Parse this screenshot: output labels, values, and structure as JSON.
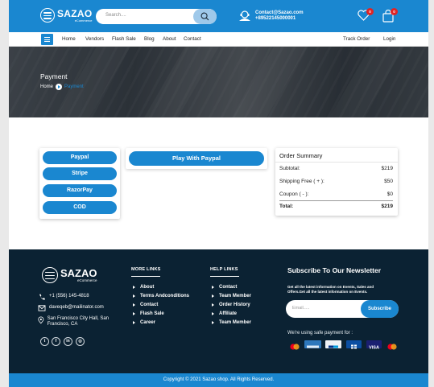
{
  "brand": {
    "name": "SAZAO",
    "tagline": "eCommerce"
  },
  "search": {
    "placeholder": "Search....",
    "icon": "search-icon"
  },
  "header_contact": {
    "email": "Contact@Sazao.com",
    "phone": "+89522145000001"
  },
  "wishlist": {
    "count": "0",
    "icon": "heart-icon"
  },
  "cart": {
    "count": "0",
    "icon": "shopping-bag-icon"
  },
  "nav": {
    "menu_icon": "hamburger-icon",
    "items": [
      {
        "label": "Home"
      },
      {
        "label": "Vendors"
      },
      {
        "label": "Flash Sale"
      },
      {
        "label": "Blog"
      },
      {
        "label": "About"
      },
      {
        "label": "Contact"
      }
    ],
    "track_order": "Track Order",
    "login": "Login"
  },
  "hero": {
    "title": "Payment",
    "breadcrumb_home": "Home",
    "breadcrumb_current": "Payment"
  },
  "payment_methods": [
    {
      "label": "Paypal"
    },
    {
      "label": "Stripe"
    },
    {
      "label": "RazorPay"
    },
    {
      "label": "COD"
    }
  ],
  "paypal_button": "Play With Paypal",
  "order_summary": {
    "title": "Order Summary",
    "rows": [
      {
        "label": "Subtotal:",
        "value": "$219"
      },
      {
        "label": "Shipping Free ( + ):",
        "value": "$50"
      },
      {
        "label": "Coupon ( - ):",
        "value": "$0"
      }
    ],
    "total_label": "Total:",
    "total_value": "$219"
  },
  "footer": {
    "brand": "SAZAO",
    "tagline": "eCommerce",
    "phone": "+1 (556) 145-4818",
    "email": "daveqeb@mailinator.com",
    "address": "San Francisco City Hall, San Francisco, CA",
    "social": [
      "twitter-icon",
      "facebook-icon",
      "linkedin-icon",
      "instagram-icon"
    ],
    "more_links_title": "MORE LINKS",
    "more_links": [
      "About",
      "Terms Andconditions",
      "Contact",
      "Flash Sale",
      "Career"
    ],
    "help_links_title": "HELP LINKS",
    "help_links": [
      "Contact",
      "Team Member",
      "Order History",
      "Affiliate",
      "Team Member"
    ],
    "newsletter_title": "Subscribe To Our Newsletter",
    "newsletter_text": "Get all the latest information on Events, Sales and Offers.Get all the latest information on Events.",
    "email_placeholder": "Email.....",
    "subscribe_label": "Subscribe",
    "safe_payment": "We're using safe payment for :",
    "payment_icons": [
      "mastercard-icon",
      "amex-icon",
      "paypal-icon",
      "card-icon",
      "visa-icon",
      "mastercard-icon"
    ]
  },
  "copyright": "Copyright © 2021 Sazao shop. All Rights Reserved.",
  "colors": {
    "primary": "#1a87d0",
    "footer_bg": "#0b2233",
    "badge": "#e02424"
  }
}
